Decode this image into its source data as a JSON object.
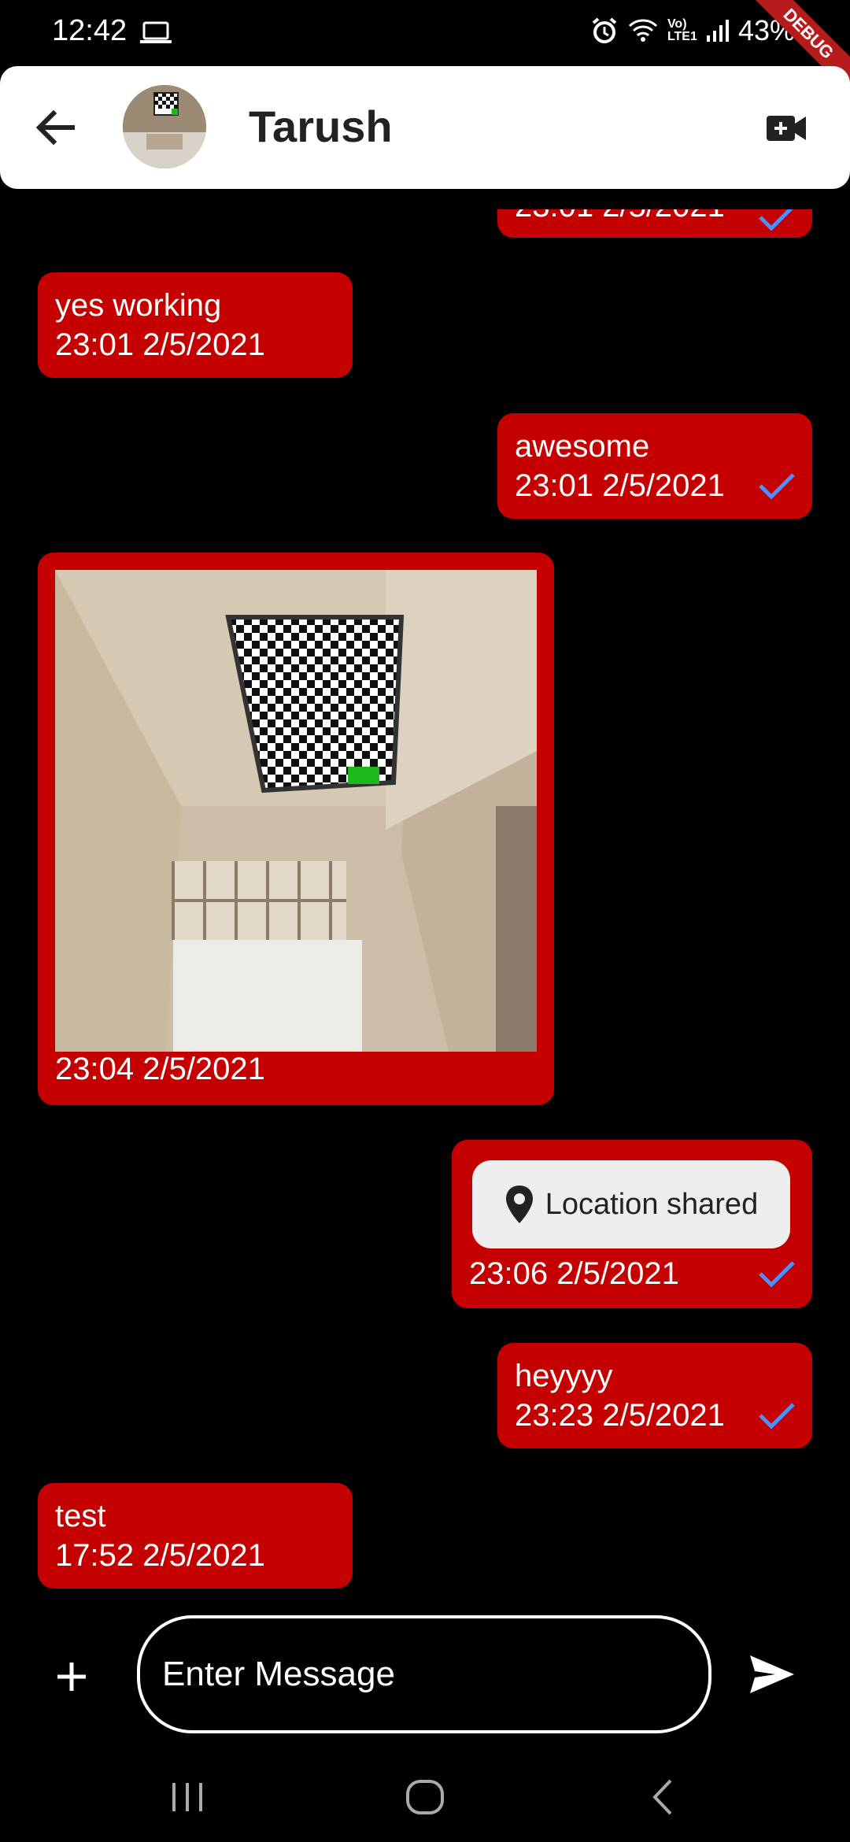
{
  "status_bar": {
    "time": "12:42",
    "battery": "43%",
    "debug_label": "DEBUG",
    "network_label": "Vo) LTE1"
  },
  "app_bar": {
    "contact_name": "Tarush"
  },
  "colors": {
    "bubble": "#c40000",
    "check": "#4a90ff",
    "background": "#000000"
  },
  "messages": [
    {
      "text": "",
      "time": "23:01 2/5/2021",
      "sent": true,
      "read": true
    },
    {
      "text": "yes working",
      "time": "23:01 2/5/2021",
      "sent": false
    },
    {
      "text": "awesome",
      "time": "23:01 2/5/2021",
      "sent": true,
      "read": true
    },
    {
      "type": "image",
      "time": "23:04 2/5/2021",
      "sent": false
    },
    {
      "type": "location",
      "label": "Location shared",
      "time": "23:06 2/5/2021",
      "sent": true,
      "read": true
    },
    {
      "text": "heyyyy",
      "time": "23:23 2/5/2021",
      "sent": true,
      "read": true
    },
    {
      "text": "test",
      "time": "17:52 2/5/2021",
      "sent": false
    }
  ],
  "composer": {
    "placeholder": "Enter Message"
  },
  "icons": {
    "back": "arrow-back-icon",
    "video": "video-call-icon",
    "add": "plus-icon",
    "send": "send-icon",
    "location": "location-pin-icon",
    "check": "check-icon"
  }
}
